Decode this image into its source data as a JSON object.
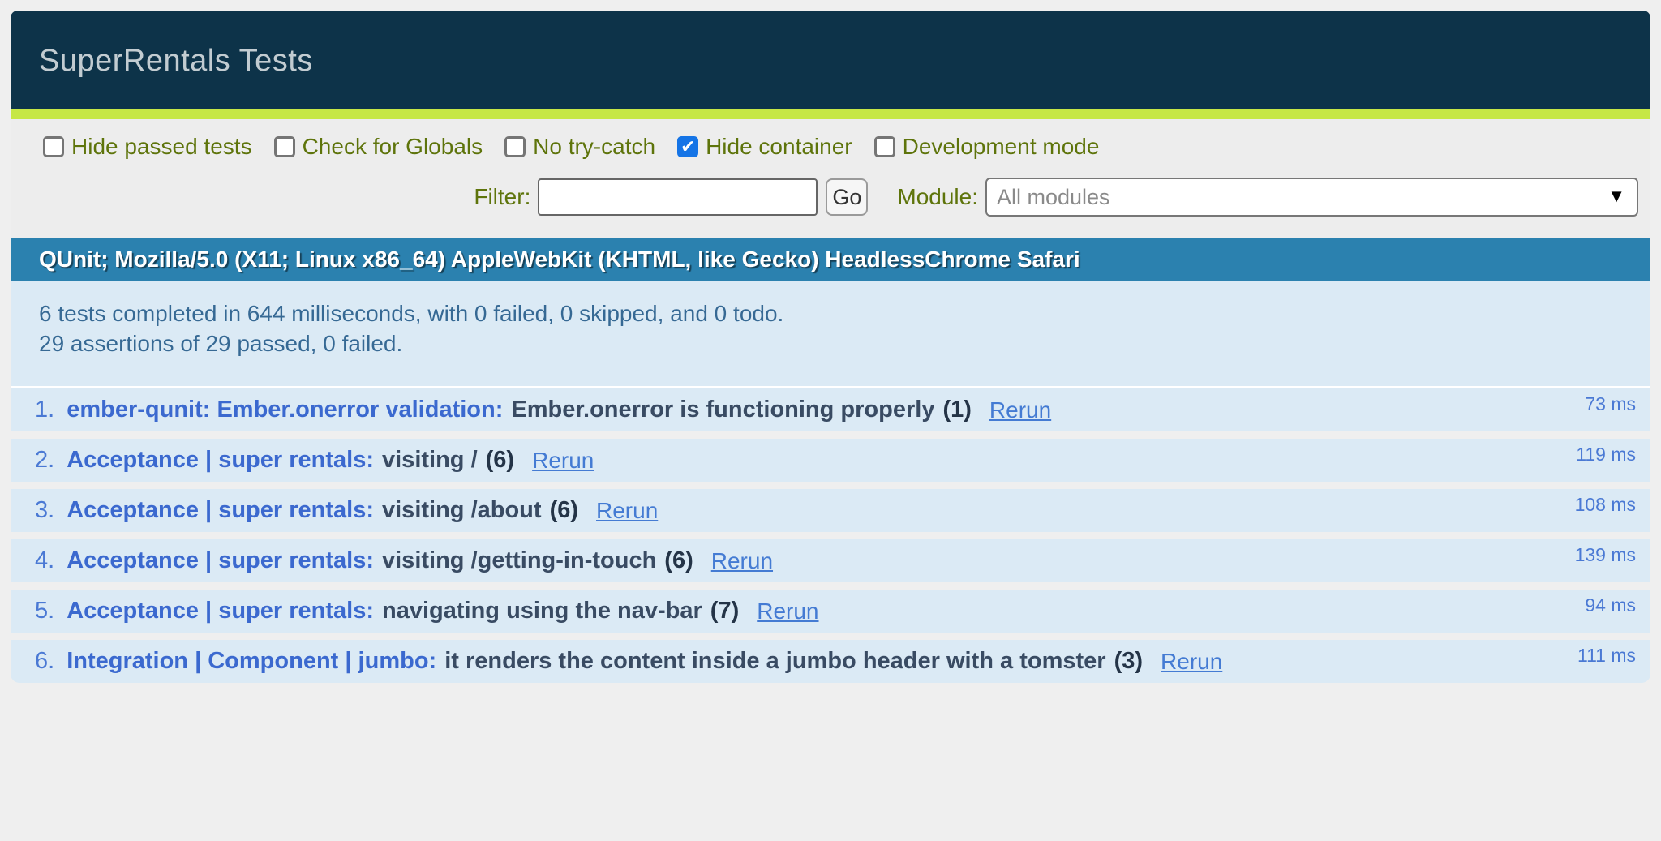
{
  "header": {
    "title": "SuperRentals Tests",
    "bg_color": "#0d3349",
    "title_color": "#c2ccd1",
    "pass_banner_color": "#c6e746"
  },
  "toolbar": {
    "label_color": "#5e740b",
    "checkboxes": [
      {
        "label": "Hide passed tests",
        "checked": false
      },
      {
        "label": "Check for Globals",
        "checked": false
      },
      {
        "label": "No try-catch",
        "checked": false
      },
      {
        "label": "Hide container",
        "checked": true
      },
      {
        "label": "Development mode",
        "checked": false
      }
    ],
    "checked_color": "#1574e6",
    "filter_label": "Filter:",
    "filter_value": "",
    "go_label": "Go",
    "module_label": "Module:",
    "module_selected": "All modules"
  },
  "useragent": {
    "text": "QUnit; Mozilla/5.0 (X11; Linux x86_64) AppleWebKit (KHTML, like Gecko) HeadlessChrome Safari",
    "bg_color": "#2b81af"
  },
  "summary": {
    "line1": "6 tests completed in 644 milliseconds, with 0 failed, 0 skipped, and 0 todo.",
    "line2": "29 assertions of 29 passed, 0 failed.",
    "bg_color": "#dbeaf5",
    "text_color": "#366994"
  },
  "tests": [
    {
      "num": "1.",
      "module": "ember-qunit: Ember.onerror validation:",
      "name": "Ember.onerror is functioning properly",
      "counts": "(1)",
      "rerun": "Rerun",
      "runtime": "73 ms"
    },
    {
      "num": "2.",
      "module": "Acceptance | super rentals:",
      "name": "visiting /",
      "counts": "(6)",
      "rerun": "Rerun",
      "runtime": "119 ms"
    },
    {
      "num": "3.",
      "module": "Acceptance | super rentals:",
      "name": "visiting /about",
      "counts": "(6)",
      "rerun": "Rerun",
      "runtime": "108 ms"
    },
    {
      "num": "4.",
      "module": "Acceptance | super rentals:",
      "name": "visiting /getting-in-touch",
      "counts": "(6)",
      "rerun": "Rerun",
      "runtime": "139 ms"
    },
    {
      "num": "5.",
      "module": "Acceptance | super rentals:",
      "name": "navigating using the nav-bar",
      "counts": "(7)",
      "rerun": "Rerun",
      "runtime": "94 ms"
    },
    {
      "num": "6.",
      "module": "Integration | Component | jumbo:",
      "name": "it renders the content inside a jumbo header with a tomster",
      "counts": "(3)",
      "rerun": "Rerun",
      "runtime": "111 ms"
    }
  ],
  "icons": {
    "checkmark": "✔",
    "dropdown_arrow": "▼"
  }
}
